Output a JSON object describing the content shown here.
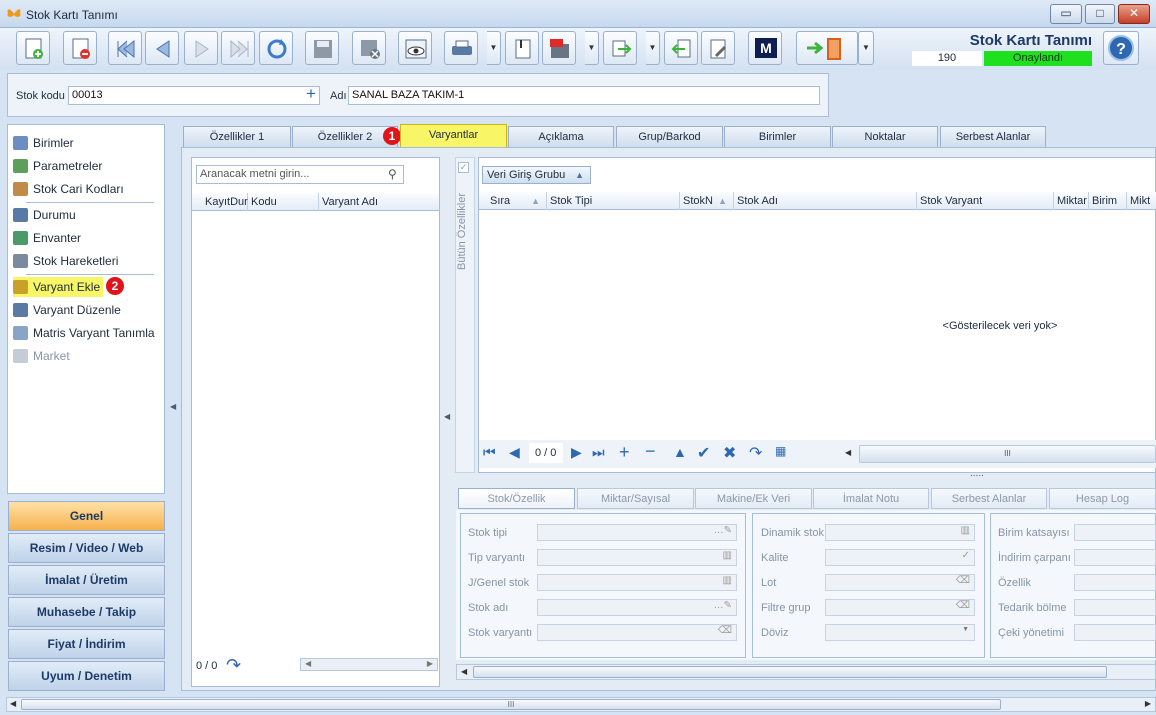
{
  "window": {
    "title": "Stok Kartı Tanımı",
    "min": "▭",
    "max": "□",
    "close": "✕"
  },
  "header": {
    "title": "Stok Kartı Tanımı",
    "number": "190",
    "status": "Onaylandı",
    "status_color": "#1ee01e"
  },
  "toolbar": {
    "icons": [
      "new-icon",
      "delete-icon",
      "first-icon",
      "prev-icon",
      "next-icon",
      "last-icon",
      "refresh-icon",
      "save-icon",
      "save-close-icon",
      "preview-icon",
      "print-icon",
      "attach-icon",
      "pdf-icon",
      "export-icon",
      "import-icon",
      "tools-icon",
      "m-icon",
      "exit-icon"
    ],
    "m_label": "M"
  },
  "form": {
    "code_label": "Stok kodu",
    "code_value": "00013",
    "name_label": "Adı",
    "name_value": "SANAL BAZA TAKIM-1",
    "plus": "+"
  },
  "nav": {
    "items": [
      "Birimler",
      "Parametreler",
      "Stok Cari Kodları",
      "Durumu",
      "Envanter",
      "Stok Hareketleri",
      "Varyant Ekle",
      "Varyant Düzenle",
      "Matris Varyant Tanımla",
      "Market"
    ],
    "badge": "2"
  },
  "groups": [
    "Genel",
    "Resim / Video / Web",
    "İmalat / Üretim",
    "Muhasebe / Takip",
    "Fiyat / İndirim",
    "Uyum / Denetim"
  ],
  "tabs": [
    "Özellikler 1",
    "Özellikler 2",
    "Varyantlar",
    "Açıklama",
    "Grup/Barkod",
    "Birimler",
    "Noktalar",
    "Serbest Alanlar"
  ],
  "tab_badge": "1",
  "left_grid": {
    "search_placeholder": "Aranacak metni girin...",
    "columns": [
      "KayıtDur",
      "Kodu",
      "Varyant Adı"
    ],
    "counter": "0 / 0"
  },
  "vertical_label": "Bütün Özellikler",
  "main_grid": {
    "group_button": "Veri Giriş Grubu",
    "columns": [
      "Sıra",
      "Stok Tipi",
      "StokNo",
      "Stok Adı",
      "Stok Varyant",
      "Miktar",
      "Birim",
      "Mikt"
    ],
    "empty": "<Gösterilecek veri yok>",
    "counter": "0 / 0",
    "scroll_grip": "III",
    "splitter": "....."
  },
  "sub_tabs": [
    "Stok/Özellik",
    "Miktar/Sayısal",
    "Makine/Ek Veri",
    "İmalat Notu",
    "Serbest Alanlar",
    "Hesap Log"
  ],
  "fields_col1": [
    "Stok tipi",
    "Tip varyantı",
    "J/Genel stok",
    "Stok adı",
    "Stok varyantı"
  ],
  "fields_col2": [
    "Dinamik stok",
    "Kalite",
    "Lot",
    "Filtre grup",
    "Döviz"
  ],
  "fields_col3": [
    "Birim katsayısı",
    "İndirim çarpanı",
    "Özellik",
    "Tedarik bölme",
    "Çeki yönetimi"
  ],
  "bottom_scroll": {
    "grip": "III"
  }
}
